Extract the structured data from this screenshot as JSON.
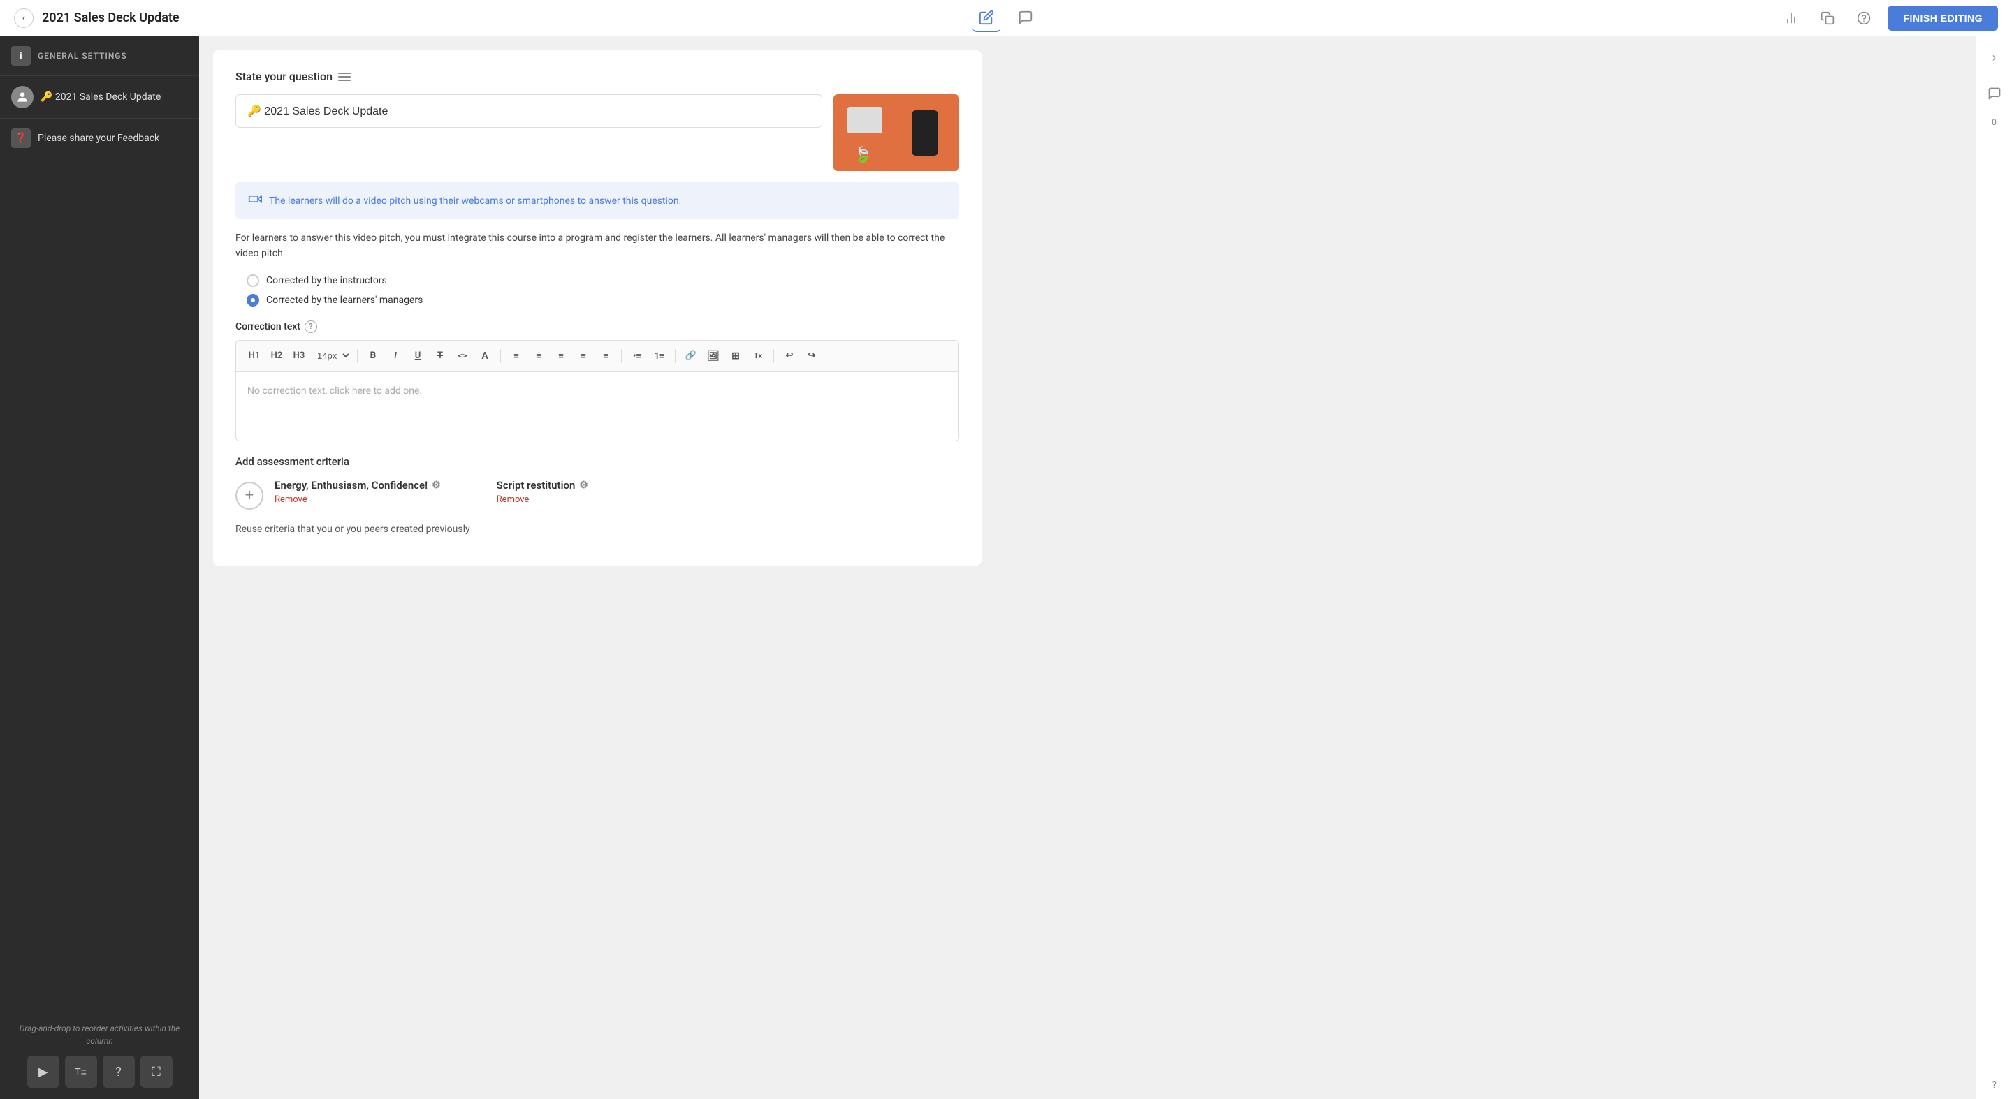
{
  "topbar": {
    "back_icon": "‹",
    "title": "2021 Sales Deck Update",
    "edit_icon": "✏",
    "chat_icon": "💬",
    "bar_chart_icon": "📊",
    "copy_icon": "⧉",
    "info_icon": "ℹ",
    "finish_label": "FINISH EDITING"
  },
  "sidebar": {
    "general_label": "GENERAL SETTINGS",
    "general_icon": "i",
    "items": [
      {
        "label": "🔑 2021 Sales Deck Update",
        "type": "avatar"
      },
      {
        "label": "Please share your Feedback",
        "type": "feedback",
        "icon": "❓"
      }
    ],
    "drag_hint": "Drag-and-drop to reorder activities within the column",
    "tools": [
      {
        "icon": "▶",
        "name": "play"
      },
      {
        "icon": "T≡",
        "name": "text"
      },
      {
        "icon": "?",
        "name": "question"
      },
      {
        "icon": "⛶",
        "name": "layout"
      }
    ]
  },
  "main": {
    "state_question_label": "State your question",
    "question_value": "🔑 2021 Sales Deck Update",
    "video_pitch_text": "The learners will do a video pitch using their webcams or smartphones to answer this question.",
    "info_text": "For learners to answer this video pitch, you must integrate this course into a program and register the learners. All learners' managers will then be able to correct the video pitch.",
    "radio_options": [
      {
        "label": "Corrected by the instructors",
        "selected": false
      },
      {
        "label": "Corrected by the learners' managers",
        "selected": true
      }
    ],
    "correction_label": "Correction text",
    "editor_placeholder": "No correction text, click here to add one.",
    "toolbar": {
      "h1": "H1",
      "h2": "H2",
      "h3": "H3",
      "font_size": "14px",
      "bold": "B",
      "italic": "I",
      "underline": "U",
      "strikethrough": "T̶",
      "code": "<>",
      "align_left": "≡",
      "align_center": "≡",
      "align_right": "≡",
      "align_justify": "≡",
      "indent": "≡",
      "bullet": "•≡",
      "numbered": "1≡",
      "link": "🔗",
      "image": "🖼",
      "table": "⊞",
      "clear": "Tx",
      "undo": "↩",
      "redo": "↪"
    },
    "assessment_label": "Add assessment criteria",
    "add_btn_icon": "+",
    "criteria": [
      {
        "name": "Energy, Enthusiasm, Confidence!",
        "has_gear": true,
        "remove_label": "Remove"
      },
      {
        "name": "Script restitution",
        "has_gear": true,
        "remove_label": "Remove"
      }
    ],
    "reuse_text": "Reuse criteria that you or you peers created previously"
  },
  "right_panel": {
    "chevron": "›",
    "chat_icon": "💬",
    "comment_count": "0",
    "help": "?"
  }
}
